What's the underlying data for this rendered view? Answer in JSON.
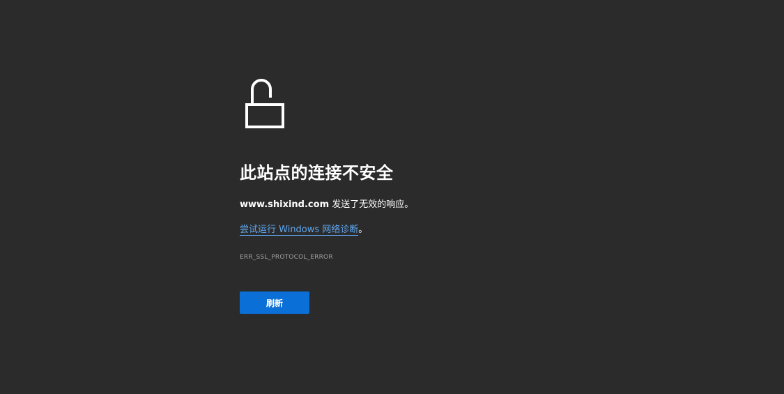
{
  "page": {
    "icon": "unlocked-padlock-icon",
    "title": "此站点的连接不安全",
    "message": {
      "host": "www.shixind.com",
      "text": " 发送了无效的响应。"
    },
    "suggestion": {
      "link_text": "尝试运行 Windows 网络诊断",
      "suffix": "。"
    },
    "error_code": "ERR_SSL_PROTOCOL_ERROR",
    "refresh_label": "刷新"
  },
  "colors": {
    "background": "#2b2b2b",
    "text": "#ffffff",
    "link": "#5fa7f0",
    "button": "#0a6fd6",
    "error_code": "#a0a0a0"
  }
}
